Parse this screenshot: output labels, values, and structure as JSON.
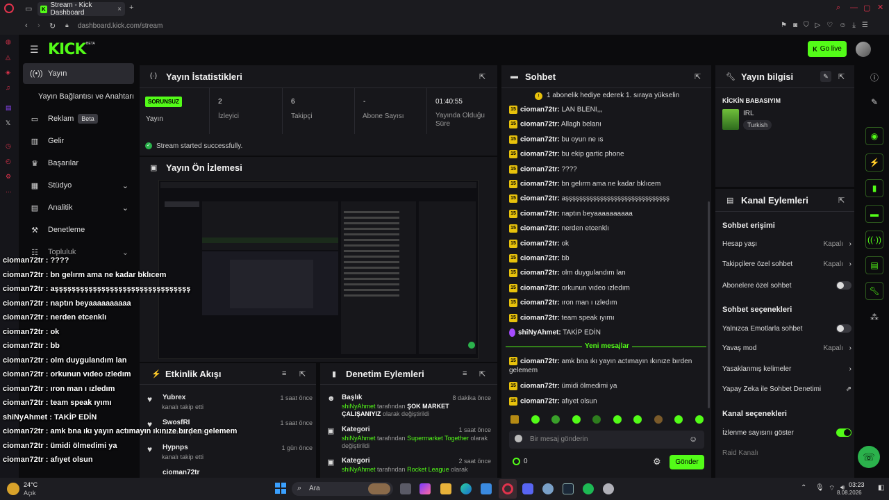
{
  "browser": {
    "tab_title": "Stream - Kick Dashboard",
    "new_tab": "+",
    "url": "dashboard.kick.com/stream"
  },
  "header": {
    "logo": "KICK",
    "beta": "BETA",
    "go_live": "Go live"
  },
  "sidebar": {
    "items": [
      {
        "label": "Yayın",
        "icon": "broadcast-icon"
      },
      {
        "label": "Yayın Bağlantısı ve Anahtarı",
        "icon": ""
      },
      {
        "label": "Reklam",
        "icon": "ad-icon",
        "badge": "Beta"
      },
      {
        "label": "Gelir",
        "icon": "chart-icon"
      },
      {
        "label": "Başarılar",
        "icon": "trophy-icon"
      },
      {
        "label": "Stüdyo",
        "icon": "studio-icon"
      },
      {
        "label": "Analitik",
        "icon": "analytics-icon"
      },
      {
        "label": "Denetleme",
        "icon": "hammer-icon"
      },
      {
        "label": "Topluluk",
        "icon": "community-icon"
      }
    ]
  },
  "stats": {
    "title": "Yayın İstatistikleri",
    "status_badge": "SORUNSUZ",
    "status_label": "Yayın",
    "viewers_value": "2",
    "viewers_label": "İzleyici",
    "followers_value": "6",
    "followers_label": "Takipçi",
    "subs_value": "-",
    "subs_label": "Abone Sayısı",
    "uptime_value": "01:40:55",
    "uptime_label": "Yayında Olduğu Süre",
    "success_message": "Stream started successfully."
  },
  "preview": {
    "title": "Yayın Ön İzlemesi"
  },
  "activity": {
    "title": "Etkinlik Akışı",
    "items": [
      {
        "name": "Yubrex",
        "desc": "kanalı takip etti",
        "time": "1 saat önce"
      },
      {
        "name": "SwosfRI",
        "desc": "kanalı takip etti",
        "time": "1 saat önce"
      },
      {
        "name": "Hypnps",
        "desc": "kanalı takip etti",
        "time": "1 gün önce"
      },
      {
        "name": "cioman72tr",
        "desc": "",
        "time": ""
      }
    ]
  },
  "moderation": {
    "title": "Denetim Eylemleri",
    "items": [
      {
        "title": "Başlık",
        "time": "8 dakika önce",
        "user": "shiNyAhmet",
        "mid": "tarafından",
        "value": "ŞOK MARKET ÇALIŞANIYIZ",
        "tail": "olarak değiştirildi"
      },
      {
        "title": "Kategori",
        "time": "1 saat önce",
        "user": "shiNyAhmet",
        "mid": "tarafından",
        "value": "Supermarket Together",
        "tail": "olarak değiştirildi"
      },
      {
        "title": "Kategori",
        "time": "2 saat önce",
        "user": "shiNyAhmet",
        "mid": "tarafından",
        "value": "Rocket League",
        "tail": "olarak"
      }
    ]
  },
  "chat": {
    "title": "Sohbet",
    "pinned": "1 abonelik hediye ederek 1. sıraya yükselin",
    "messages": [
      {
        "user": "cioman72tr:",
        "text": "LAN BLENI,,,"
      },
      {
        "user": "cioman72tr:",
        "text": "Allagh belanı"
      },
      {
        "user": "cioman72tr:",
        "text": "bu oyun ne ıs"
      },
      {
        "user": "cioman72tr:",
        "text": "bu ekip gartic phone"
      },
      {
        "user": "cioman72tr:",
        "text": "????"
      },
      {
        "user": "cioman72tr:",
        "text": "bn gelırm ama ne kadar bklıcem"
      },
      {
        "user": "cioman72tr:",
        "text": "aşşşşşşşşşşşşşşşşşşşşşşşşşşşşşş"
      },
      {
        "user": "cioman72tr:",
        "text": "naptın beyaaaaaaaaaa"
      },
      {
        "user": "cioman72tr:",
        "text": "nerden etcenklı"
      },
      {
        "user": "cioman72tr:",
        "text": "ok"
      },
      {
        "user": "cioman72tr:",
        "text": "bb"
      },
      {
        "user": "cioman72tr:",
        "text": "olm duygulandım lan"
      },
      {
        "user": "cioman72tr:",
        "text": "orkunun vıdeo ızledım"
      },
      {
        "user": "cioman72tr:",
        "text": "ıron man ı ızledım"
      },
      {
        "user": "cioman72tr:",
        "text": "team speak ıyımı"
      },
      {
        "user": "shiNyAhmet:",
        "text": "TAKİP EDİN"
      }
    ],
    "new_messages": "Yeni mesajlar",
    "new": [
      {
        "user": "cioman72tr:",
        "text": "amk bna ıkı yayın actımayın ıkınıze bırden gelemem"
      },
      {
        "user": "cioman72tr:",
        "text": "ümidi ölmedimi ya"
      },
      {
        "user": "cioman72tr:",
        "text": "afıyet olsun"
      }
    ],
    "placeholder": "Bir mesaj gönderin",
    "points": "0",
    "send": "Gönder"
  },
  "stream_info": {
    "title": "Yayın bilgisi",
    "stream_title": "KİCKİN BABASIYIM",
    "category": "IRL",
    "language": "Turkish"
  },
  "channel_actions": {
    "title": "Kanal Eylemleri",
    "chat_access": "Sohbet erişimi",
    "account_age": "Hesap yaşı",
    "account_age_val": "Kapalı",
    "followers_only": "Takipçilere özel sohbet",
    "followers_only_val": "Kapalı",
    "subs_only": "Abonelere özel sohbet",
    "chat_options": "Sohbet seçenekleri",
    "emotes_only": "Yalnızca Emotlarla sohbet",
    "slow_mode": "Yavaş mod",
    "slow_mode_val": "Kapalı",
    "banned_words": "Yasaklanmış kelimeler",
    "ai_mod": "Yapay Zeka ile Sohbet Denetimi",
    "channel_options": "Kanal seçenekleri",
    "show_viewers": "İzlenme sayısını göster",
    "raid": "Raid Kanalı"
  },
  "overlay_chat": [
    "cioman72tr : ????",
    "cioman72tr : bn gelırm ama ne kadar bklıcem",
    "cioman72tr : aşşşşşşşşşşşşşşşşşşşşşşşşşşşşşşşş",
    "cioman72tr : naptın beyaaaaaaaaaa",
    "cioman72tr : nerden etcenklı",
    "cioman72tr : ok",
    "cioman72tr : bb",
    "cioman72tr : olm duygulandım lan",
    "cioman72tr : orkunun vıdeo ızledım",
    "cioman72tr : ıron man ı ızledım",
    "cioman72tr : team speak ıyımı",
    "shiNyAhmet : TAKİP EDİN",
    "cioman72tr : amk bna ıkı yayın actımayın ıkınıze bırden gelemem",
    "cioman72tr : ümidi ölmedimi ya",
    "cioman72tr : afıyet olsun"
  ],
  "taskbar": {
    "weather_temp": "24°C",
    "weather_desc": "Açık",
    "search": "Ara",
    "time": "03:23",
    "date": "8.08.2026"
  },
  "colors": {
    "accent": "#53fc18",
    "panel": "#17171b",
    "background": "#0b0b0d",
    "sub_badge": "#e8c20c"
  }
}
